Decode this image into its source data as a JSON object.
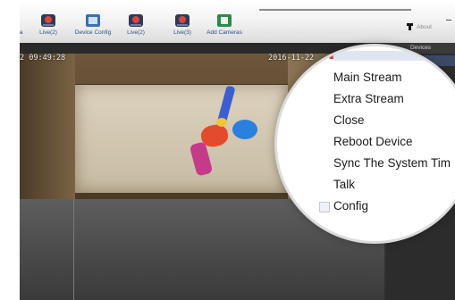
{
  "toolbar": {
    "items": [
      {
        "label": "Live(2)",
        "icon": "camera-icon"
      },
      {
        "label": "Device Config",
        "icon": "monitor-icon"
      },
      {
        "label": "Live(2)",
        "icon": "camera-icon"
      },
      {
        "label": "Live(3)",
        "icon": "camera-icon"
      },
      {
        "label": "Add Cameras",
        "icon": "add-camera-icon"
      }
    ],
    "partial_label": "Ma",
    "about_label": "About"
  },
  "devices_tab": "Devices",
  "video": {
    "time": "2 09:49:28",
    "date": "2016-11-22"
  },
  "context_menu": {
    "items": [
      "Main Stream",
      "Extra Stream",
      "Close",
      "Reboot Device",
      "Sync The System Tim",
      "Talk",
      "Config"
    ]
  }
}
